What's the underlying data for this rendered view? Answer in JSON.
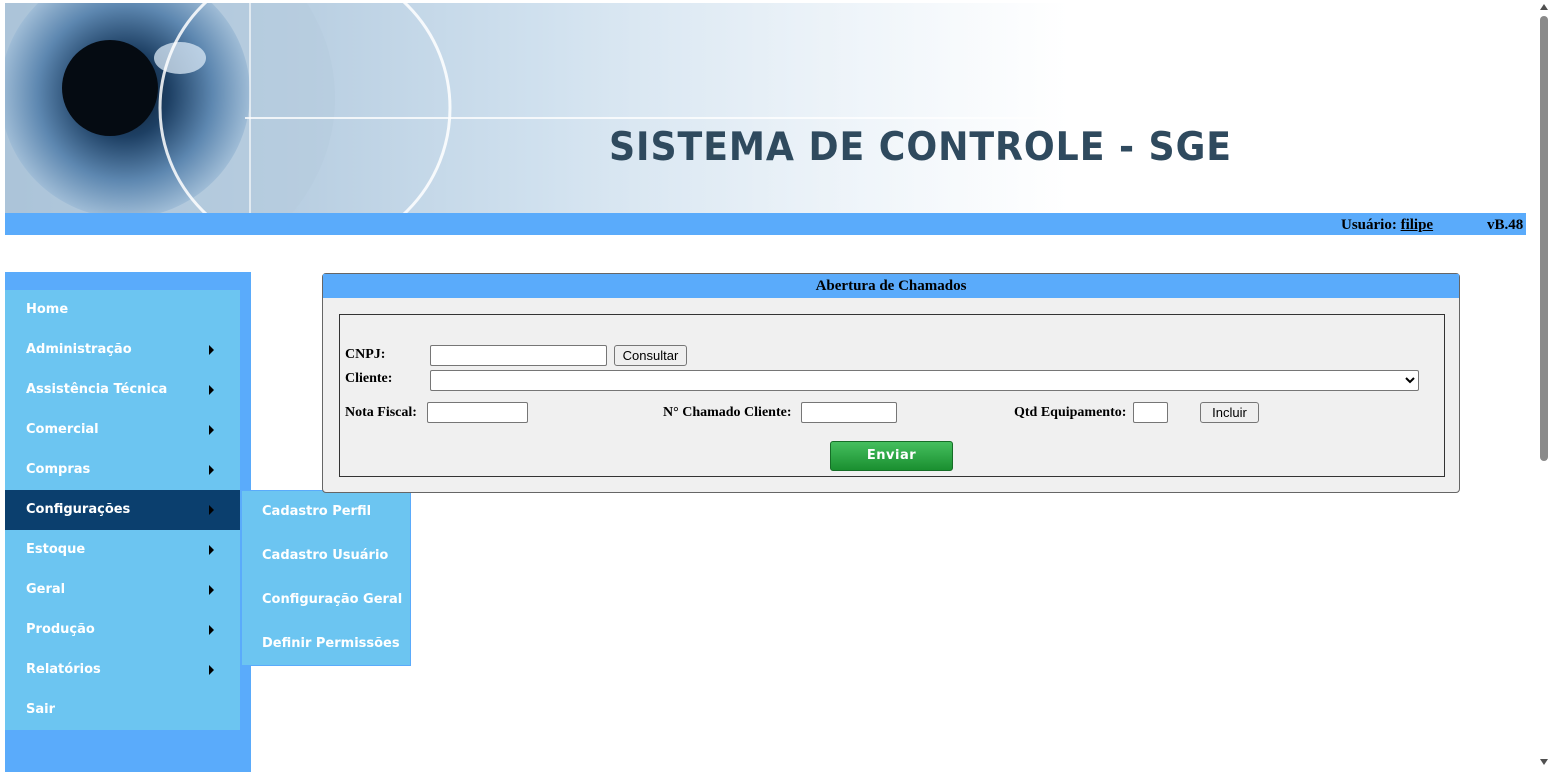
{
  "header": {
    "title": "SISTEMA DE CONTROLE - SGE",
    "user_label": "Usuário:",
    "user_name": "filipe",
    "version": "vB.48"
  },
  "sidebar": {
    "items": [
      {
        "label": "Home",
        "has_submenu": false
      },
      {
        "label": "Administração",
        "has_submenu": true
      },
      {
        "label": "Assistência Técnica",
        "has_submenu": true
      },
      {
        "label": "Comercial",
        "has_submenu": true
      },
      {
        "label": "Compras",
        "has_submenu": true
      },
      {
        "label": "Configurações",
        "has_submenu": true,
        "active": true
      },
      {
        "label": "Estoque",
        "has_submenu": true
      },
      {
        "label": "Geral",
        "has_submenu": true
      },
      {
        "label": "Produção",
        "has_submenu": true
      },
      {
        "label": "Relatórios",
        "has_submenu": true
      },
      {
        "label": "Sair",
        "has_submenu": false
      }
    ],
    "submenu": [
      "Cadastro Perfil",
      "Cadastro Usuário",
      "Configuração Geral",
      "Definir Permissões"
    ]
  },
  "form": {
    "title": "Abertura de Chamados",
    "cnpj_label": "CNPJ:",
    "cnpj_value": "",
    "consult_button": "Consultar",
    "client_label": "Cliente:",
    "client_selected": "",
    "nota_label": "Nota Fiscal:",
    "nota_value": "",
    "chamado_label": "N° Chamado Cliente:",
    "chamado_value": "",
    "qtd_label": "Qtd Equipamento:",
    "qtd_value": "",
    "include_button": "Incluir",
    "send_button": "Enviar"
  },
  "colors": {
    "bar_blue": "#5aabfb",
    "menu_blue": "#6cc5f1",
    "active_menu": "#0b3f6e",
    "send_green": "#2aa644"
  },
  "icons": {
    "submenu_arrow": "triangle-right",
    "banner_image": "eye-icon"
  }
}
